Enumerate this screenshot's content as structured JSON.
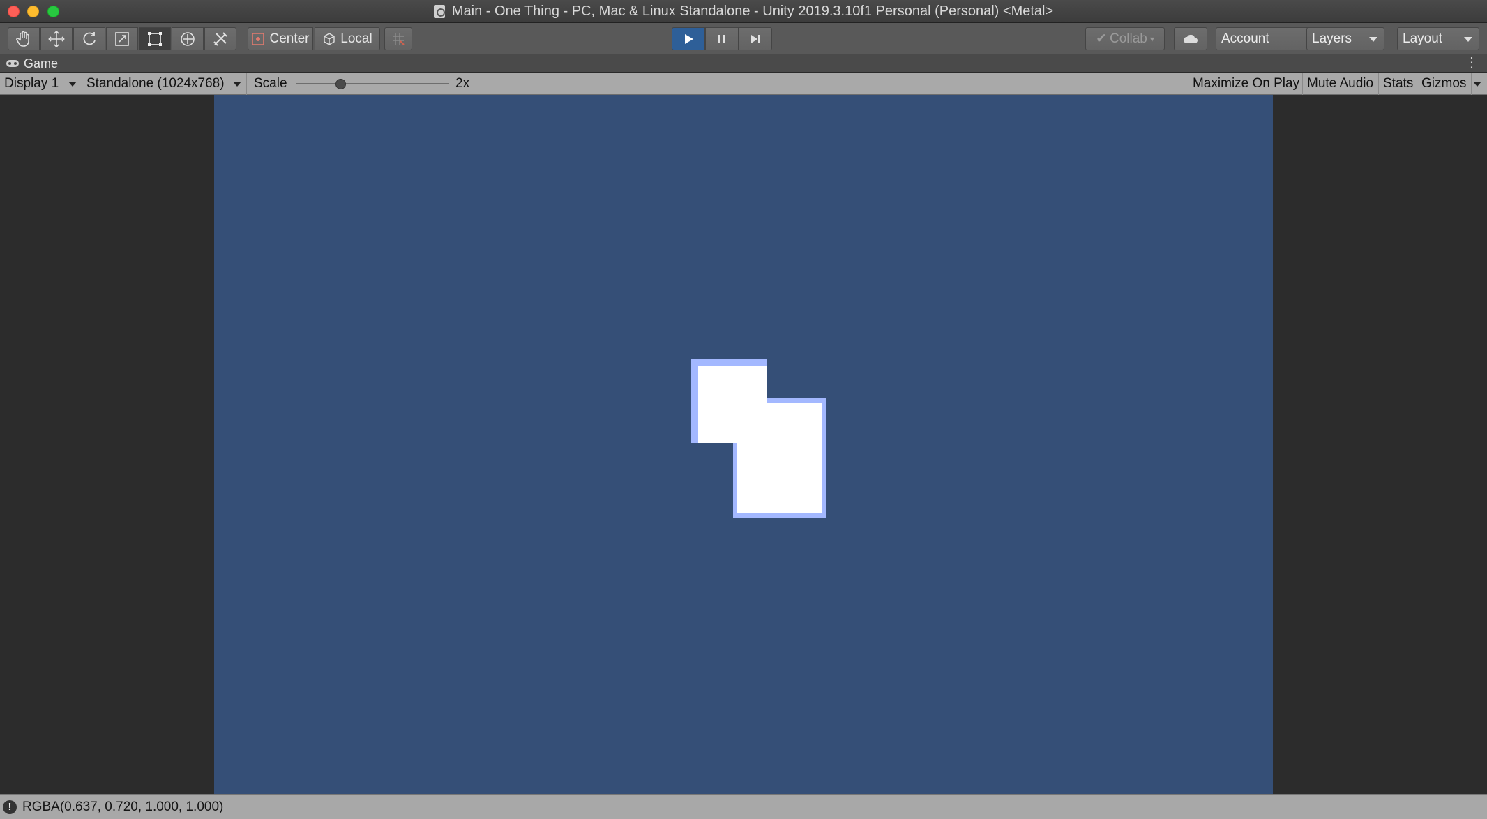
{
  "window": {
    "title": "Main - One Thing - PC, Mac & Linux Standalone - Unity 2019.3.10f1 Personal (Personal) <Metal>"
  },
  "toolbar": {
    "tools": [
      "hand-tool",
      "move-tool",
      "rotate-tool",
      "scale-tool",
      "rect-tool",
      "transform-tool",
      "custom-editor-tool"
    ],
    "active_tool": "rect-tool",
    "pivot_mode_label": "Center",
    "pivot_rotation_label": "Local",
    "play_state": "playing",
    "collab_label": "Collab",
    "account_label": "Account",
    "layers_label": "Layers",
    "layout_label": "Layout"
  },
  "game_tab": {
    "label": "Game"
  },
  "game_view": {
    "display_label": "Display 1",
    "resolution_label": "Standalone (1024x768)",
    "scale_label": "Scale",
    "scale_value_label": "2x",
    "scale_value": 2,
    "maximize_label": "Maximize On Play",
    "mute_label": "Mute Audio",
    "stats_label": "Stats",
    "gizmos_label": "Gizmos",
    "background_color": "#354f77",
    "block_color": "#ffffff",
    "block_outline_color": "#a3b8ff"
  },
  "status": {
    "message": "RGBA(0.637, 0.720, 1.000, 1.000)"
  }
}
